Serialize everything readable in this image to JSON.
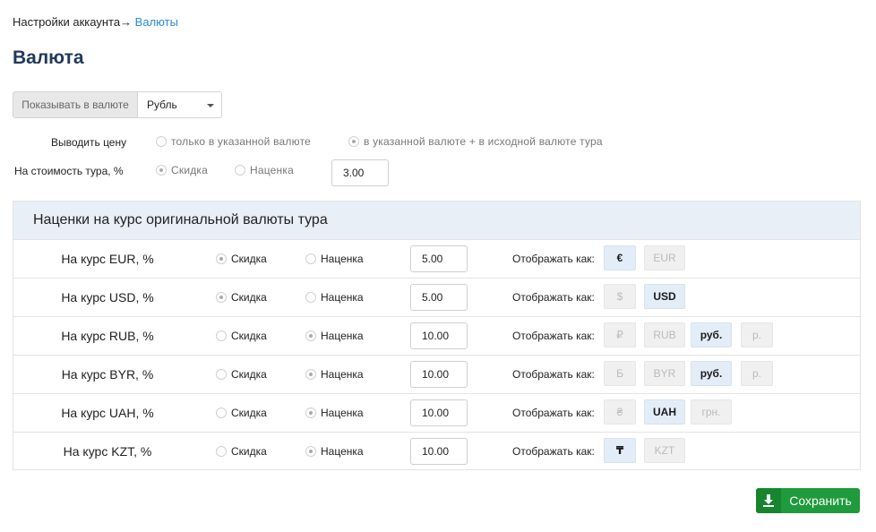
{
  "breadcrumb": {
    "parent": "Настройки аккаунта",
    "arrow": "→",
    "current": "Валюты"
  },
  "page_title": "Валюта",
  "currency_select": {
    "label": "Показывать в валюте",
    "value": "Рубль"
  },
  "price_display": {
    "label": "Выводить цену",
    "options": [
      "только в указанной валюте",
      "в указанной валюте + в исходной валюте тура"
    ],
    "selected": 1
  },
  "tour_cost": {
    "label": "На стоимость тура, %",
    "options": [
      "Скидка",
      "Наценка"
    ],
    "selected": 0,
    "value": "3.00"
  },
  "markup_panel": {
    "title": "Наценки на курс оригинальной валюты тура",
    "display_label": "Отображать как:",
    "option_discount": "Скидка",
    "option_markup": "Наценка",
    "rows": [
      {
        "label": "На курс EUR, %",
        "selected": "discount",
        "value": "5.00",
        "symbols": [
          {
            "text": "€",
            "active": true
          },
          {
            "text": "EUR",
            "active": false
          }
        ]
      },
      {
        "label": "На курс USD, %",
        "selected": "discount",
        "value": "5.00",
        "symbols": [
          {
            "text": "$",
            "active": false
          },
          {
            "text": "USD",
            "active": true
          }
        ]
      },
      {
        "label": "На курс RUB, %",
        "selected": "markup",
        "value": "10.00",
        "symbols": [
          {
            "text": "₽",
            "active": false
          },
          {
            "text": "RUB",
            "active": false
          },
          {
            "text": "руб.",
            "active": true
          },
          {
            "text": "р.",
            "active": false
          }
        ]
      },
      {
        "label": "На курс BYR, %",
        "selected": "markup",
        "value": "10.00",
        "symbols": [
          {
            "text": "Ƃ",
            "active": false
          },
          {
            "text": "BYR",
            "active": false
          },
          {
            "text": "руб.",
            "active": true
          },
          {
            "text": "р.",
            "active": false
          }
        ]
      },
      {
        "label": "На курс UAH, %",
        "selected": "markup",
        "value": "10.00",
        "symbols": [
          {
            "text": "₴",
            "active": false
          },
          {
            "text": "UAH",
            "active": true
          },
          {
            "text": "грн.",
            "active": false
          }
        ]
      },
      {
        "label": "На курс KZT, %",
        "selected": "markup",
        "value": "10.00",
        "symbols": [
          {
            "text": "₸",
            "active": true
          },
          {
            "text": "KZT",
            "active": false
          }
        ]
      }
    ]
  },
  "save_button": {
    "label": "Сохранить",
    "icon": "download-icon"
  },
  "colors": {
    "accent": "#2b8ad6",
    "save": "#1f9a3c",
    "panel_header": "#e8eff7",
    "title": "#1f3a5a"
  }
}
